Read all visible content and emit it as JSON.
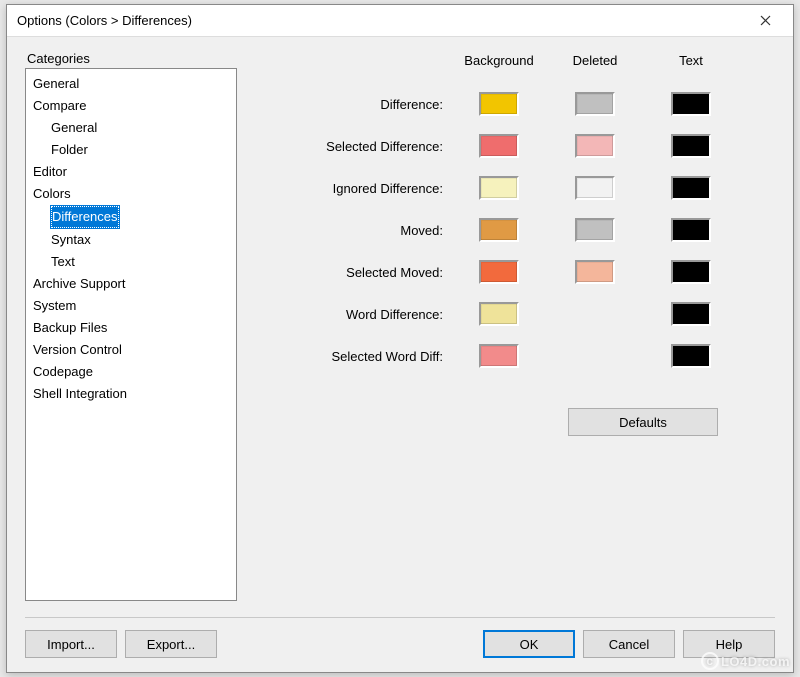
{
  "window": {
    "title": "Options (Colors > Differences)"
  },
  "categories": {
    "label": "Categories",
    "items": [
      {
        "label": "General",
        "indent": 0
      },
      {
        "label": "Compare",
        "indent": 0
      },
      {
        "label": "General",
        "indent": 1
      },
      {
        "label": "Folder",
        "indent": 1
      },
      {
        "label": "Editor",
        "indent": 0
      },
      {
        "label": "Colors",
        "indent": 0
      },
      {
        "label": "Differences",
        "indent": 1,
        "selected": true
      },
      {
        "label": "Syntax",
        "indent": 1
      },
      {
        "label": "Text",
        "indent": 1
      },
      {
        "label": "Archive Support",
        "indent": 0
      },
      {
        "label": "System",
        "indent": 0
      },
      {
        "label": "Backup Files",
        "indent": 0
      },
      {
        "label": "Version Control",
        "indent": 0
      },
      {
        "label": "Codepage",
        "indent": 0
      },
      {
        "label": "Shell Integration",
        "indent": 0
      }
    ]
  },
  "colors": {
    "headers": {
      "background": "Background",
      "deleted": "Deleted",
      "text": "Text"
    },
    "rows": [
      {
        "label": "Difference:",
        "background": "#f2c500",
        "deleted": "#c0c0c0",
        "text": "#000000"
      },
      {
        "label": "Selected Difference:",
        "background": "#ef6d6d",
        "deleted": "#f3b7b7",
        "text": "#000000"
      },
      {
        "label": "Ignored Difference:",
        "background": "#f6f2bd",
        "deleted": "#f2f2f2",
        "text": "#000000"
      },
      {
        "label": "Moved:",
        "background": "#e09a44",
        "deleted": "#c0c0c0",
        "text": "#000000"
      },
      {
        "label": "Selected Moved:",
        "background": "#f26a3d",
        "deleted": "#f4b69b",
        "text": "#000000"
      },
      {
        "label": "Word Difference:",
        "background": "#efe39a",
        "deleted": null,
        "text": "#000000"
      },
      {
        "label": "Selected Word Diff:",
        "background": "#f28b8b",
        "deleted": null,
        "text": "#000000"
      }
    ],
    "defaults_label": "Defaults"
  },
  "buttons": {
    "import": "Import...",
    "export": "Export...",
    "ok": "OK",
    "cancel": "Cancel",
    "help": "Help"
  },
  "watermark": "LO4D.com"
}
